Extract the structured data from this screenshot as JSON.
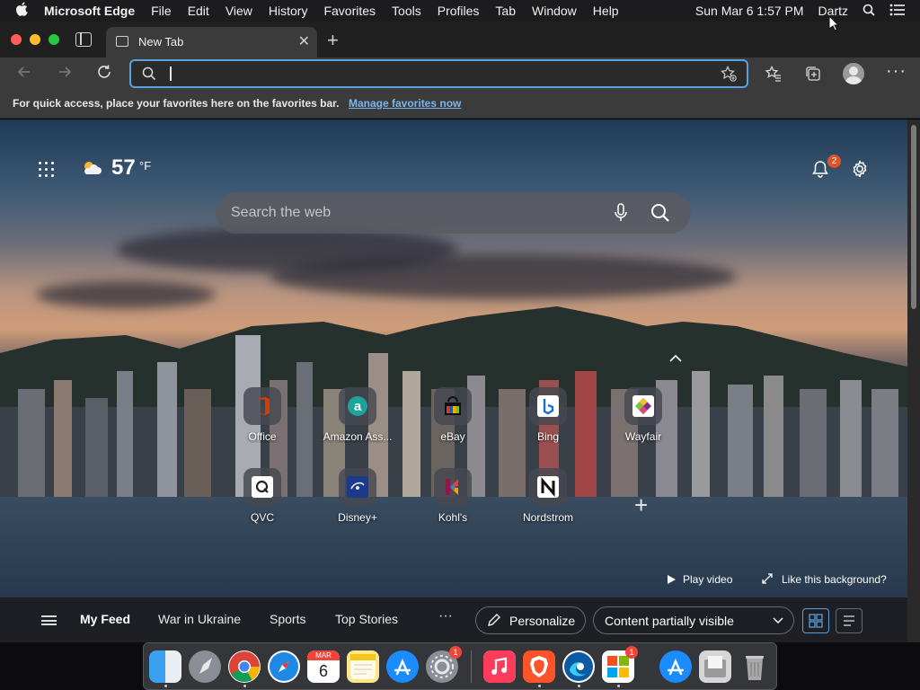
{
  "menubar": {
    "app_name": "Microsoft Edge",
    "menus": [
      "File",
      "Edit",
      "View",
      "History",
      "Favorites",
      "Tools",
      "Profiles",
      "Tab",
      "Window",
      "Help"
    ],
    "datetime": "Sun Mar 6  1:57 PM",
    "user": "Dartz"
  },
  "tab": {
    "title": "New Tab"
  },
  "address_bar": {
    "value": ""
  },
  "favorites_bar": {
    "message": "For quick access, place your favorites here on the favorites bar.",
    "link": "Manage favorites now"
  },
  "weather": {
    "temp": "57",
    "unit": "°F"
  },
  "notifications": {
    "count": "2"
  },
  "search": {
    "placeholder": "Search the web"
  },
  "quick_links": [
    {
      "label": "Office",
      "color": "#d83b01"
    },
    {
      "label": "Amazon Ass...",
      "color": "#1ba39c"
    },
    {
      "label": "eBay",
      "color": "#e53238"
    },
    {
      "label": "Bing",
      "color": "#ffffff"
    },
    {
      "label": "Wayfair",
      "color": "#7b2d8e"
    },
    {
      "label": "QVC",
      "color": "#ffffff"
    },
    {
      "label": "Disney+",
      "color": "#1c3a8c"
    },
    {
      "label": "Kohl's",
      "color": "#8b1a4a"
    },
    {
      "label": "Nordstrom",
      "color": "#ffffff"
    }
  ],
  "background": {
    "play": "Play video",
    "like": "Like this background?"
  },
  "feed": {
    "tabs": [
      "My Feed",
      "War in Ukraine",
      "Sports",
      "Top Stories"
    ],
    "personalize": "Personalize",
    "visibility": "Content partially visible"
  },
  "dock": {
    "calendar_month": "MAR",
    "calendar_day": "6",
    "badges": {
      "settings": "1",
      "office": "1"
    }
  },
  "colors": {
    "accent": "#5aa1df",
    "chrome": "#3b3b3b",
    "badge": "#e0522a"
  }
}
